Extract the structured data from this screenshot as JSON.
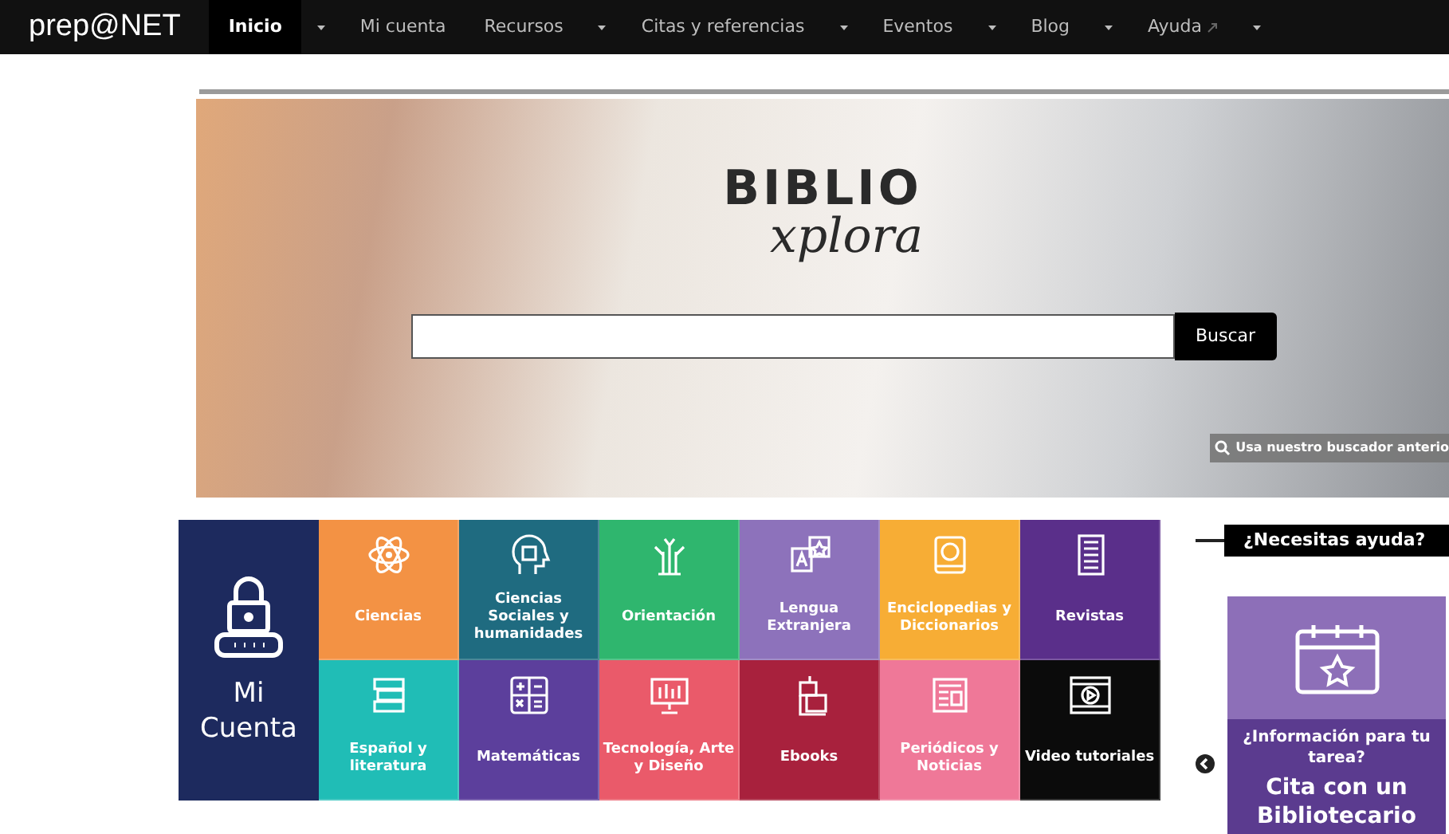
{
  "nav": {
    "logo": "prep@NET",
    "items": [
      {
        "label": "Inicio",
        "selected": true,
        "has_menu": true,
        "external": false
      },
      {
        "label": "Mi cuenta",
        "selected": false,
        "has_menu": false,
        "external": false
      },
      {
        "label": "Recursos",
        "selected": false,
        "has_menu": true,
        "external": false
      },
      {
        "label": "Citas y referencias",
        "selected": false,
        "has_menu": true,
        "external": false
      },
      {
        "label": "Eventos",
        "selected": false,
        "has_menu": true,
        "external": false
      },
      {
        "label": "Blog",
        "selected": false,
        "has_menu": true,
        "external": false
      },
      {
        "label": "Ayuda",
        "selected": false,
        "has_menu": true,
        "external": true
      }
    ]
  },
  "hero": {
    "logo_top": "BIBLIO",
    "logo_bottom": "xplora",
    "search": {
      "button": "Buscar"
    },
    "old_search_link": "Usa nuestro buscador anterio"
  },
  "account_tile": {
    "label_line1": "Mi",
    "label_line2": "Cuenta"
  },
  "tiles": [
    {
      "label": "Ciencias",
      "color": "#f39244"
    },
    {
      "label": "Ciencias Sociales y humanidades",
      "color": "#1f6b80"
    },
    {
      "label": "Orientación",
      "color": "#2fb66e"
    },
    {
      "label": "Lengua Extranjera",
      "color": "#8d72bb"
    },
    {
      "label": "Enciclopedias y Diccionarios",
      "color": "#f7ad35"
    },
    {
      "label": "Revistas",
      "color": "#5a2f8a"
    },
    {
      "label": "Español y literatura",
      "color": "#20bdb6"
    },
    {
      "label": "Matemáticas",
      "color": "#5c3f9c"
    },
    {
      "label": "Tecnología, Arte y Diseño",
      "color": "#ea5a6a"
    },
    {
      "label": "Ebooks",
      "color": "#a8213d"
    },
    {
      "label": "Periódicos y Noticias",
      "color": "#ef7898"
    },
    {
      "label": "Video tutoriales",
      "color": "#0b0b0b"
    }
  ],
  "help": {
    "heading": "¿Necesitas ayuda?",
    "card": {
      "question": "¿Información para tu tarea?",
      "title": "Cita con un Bibliotecario"
    }
  }
}
